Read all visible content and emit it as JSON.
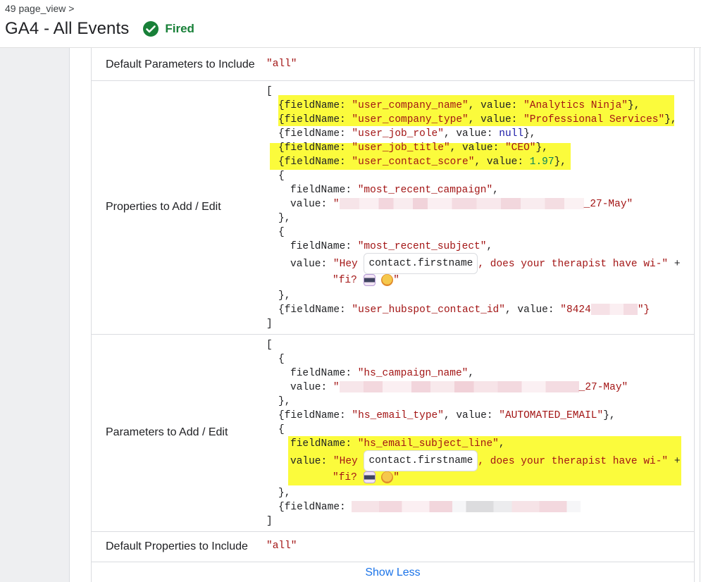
{
  "header": {
    "breadcrumb": "49 page_view >",
    "title": "GA4 - All Events",
    "status": "Fired",
    "status_color": "#188038",
    "status_icon": "check-circle-icon"
  },
  "rows": {
    "default_params": {
      "label": "Default Parameters to Include",
      "value": "\"all\""
    },
    "properties": {
      "label": "Properties to Add / Edit",
      "lines": {
        "l0": "[",
        "l1a": "{fieldName: ",
        "l1b": "\"user_company_name\"",
        "l1c": ", value: ",
        "l1d": "\"Analytics Ninja\"",
        "l1e": "},",
        "l2a": "{fieldName: ",
        "l2b": "\"user_company_type\"",
        "l2c": ", value: ",
        "l2d": "\"Professional Services\"",
        "l2e": "},",
        "l3a": "{fieldName: ",
        "l3b": "\"user_job_role\"",
        "l3c": ", value: ",
        "l3d": "null",
        "l3e": "},",
        "l4a": "{fieldName: ",
        "l4b": "\"user_job_title\"",
        "l4c": ", value: ",
        "l4d": "\"CEO\"",
        "l4e": "},",
        "l5a": "{fieldName: ",
        "l5b": "\"user_contact_score\"",
        "l5c": ", value: ",
        "l5d": "1.97",
        "l5e": "},",
        "l6": "{",
        "l7a": "fieldName: ",
        "l7b": "\"most_recent_campaign\"",
        "l7c": ",",
        "l8a": "value: ",
        "l8b": "\"",
        "l8c": "_27-May\"",
        "l9": "},",
        "l10": "{",
        "l11a": "fieldName: ",
        "l11b": "\"most_recent_subject\"",
        "l11c": ",",
        "l12a": "value: ",
        "l12b": "\"Hey ",
        "l12chip": "contact.firstname",
        "l12c": ", does your therapist have wi-\"",
        "l12d": " +",
        "l13a": "\"fi? ",
        "l13b": "\"",
        "l14": "},",
        "l15a": "{fieldName: ",
        "l15b": "\"user_hubspot_contact_id\"",
        "l15c": ", value: ",
        "l15d": "\"8424",
        "l15e": "\"}",
        "l16": "]"
      }
    },
    "parameters": {
      "label": "Parameters to Add / Edit",
      "lines": {
        "l0": "[",
        "l1": "{",
        "l2a": "fieldName: ",
        "l2b": "\"hs_campaign_name\"",
        "l2c": ",",
        "l3a": "value: ",
        "l3b": "\"",
        "l3c": "_27-May\"",
        "l4": "},",
        "l5a": "{fieldName: ",
        "l5b": "\"hs_email_type\"",
        "l5c": ", value: ",
        "l5d": "\"AUTOMATED_EMAIL\"",
        "l5e": "},",
        "l6": "{",
        "l7a": "fieldName: ",
        "l7b": "\"hs_email_subject_line\"",
        "l7c": ",",
        "l8a": "value: ",
        "l8b": "\"Hey ",
        "l8chip": "contact.firstname",
        "l8c": ", does your therapist have wi-\"",
        "l8d": " +",
        "l9a": "\"fi? ",
        "l9b": "\"",
        "l10": "},",
        "l11a": "{fieldName: ",
        "l12": "]"
      }
    },
    "default_props": {
      "label": "Default Properties to Include",
      "value": "\"all\""
    }
  },
  "footer": {
    "show_less": "Show Less"
  },
  "colors": {
    "string": "#a31515",
    "keyword": "#1a1aa6",
    "number": "#098658",
    "highlight": "#fbfb3c",
    "link": "#1a73e8"
  }
}
